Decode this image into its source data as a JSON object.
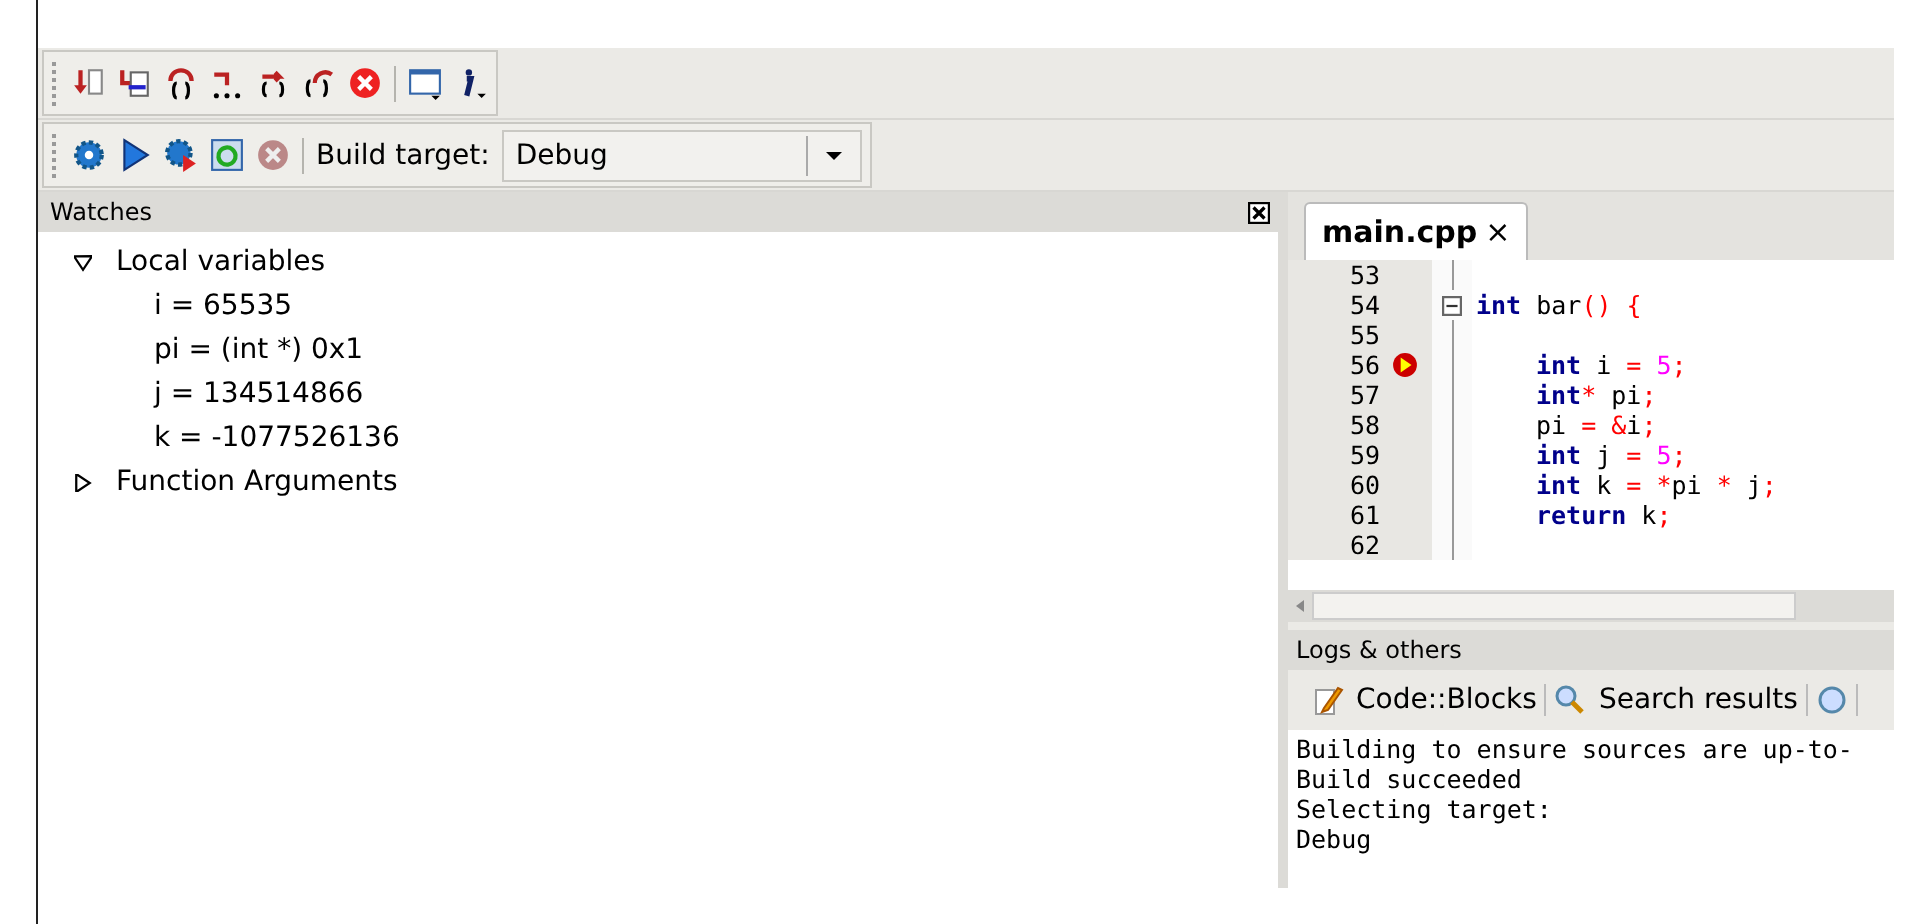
{
  "toolbar": {
    "build_target_label": "Build target:",
    "build_target_value": "Debug"
  },
  "watches": {
    "title": "Watches",
    "items": [
      {
        "label": "Local variables",
        "expanded": true,
        "children": [
          {
            "label": "i = 65535"
          },
          {
            "label": "pi = (int *) 0x1"
          },
          {
            "label": "j = 134514866"
          },
          {
            "label": "k = -1077526136"
          }
        ]
      },
      {
        "label": "Function Arguments",
        "expanded": false
      }
    ]
  },
  "editor": {
    "tab": {
      "label": "main.cpp",
      "close": "×"
    },
    "lines": [
      {
        "number": "53",
        "current": false,
        "fold": false
      },
      {
        "number": "54",
        "current": false,
        "fold": true,
        "indented": false,
        "tokens": [
          {
            "kind": "keyword",
            "text": "int"
          },
          {
            "kind": "plain",
            "text": " bar"
          },
          {
            "kind": "operator",
            "text": "() {"
          }
        ]
      },
      {
        "number": "55",
        "current": false,
        "fold": false
      },
      {
        "number": "56",
        "current": true,
        "fold": false,
        "indented": true,
        "tokens": [
          {
            "kind": "keyword",
            "text": "int"
          },
          {
            "kind": "plain",
            "text": " i "
          },
          {
            "kind": "operator",
            "text": "= "
          },
          {
            "kind": "number",
            "text": "5"
          },
          {
            "kind": "operator",
            "text": ";"
          }
        ]
      },
      {
        "number": "57",
        "current": false,
        "fold": false,
        "indented": true,
        "tokens": [
          {
            "kind": "keyword",
            "text": "int"
          },
          {
            "kind": "operator",
            "text": "*"
          },
          {
            "kind": "plain",
            "text": " pi"
          },
          {
            "kind": "operator",
            "text": ";"
          }
        ]
      },
      {
        "number": "58",
        "current": false,
        "fold": false,
        "indented": true,
        "tokens": [
          {
            "kind": "plain",
            "text": "pi "
          },
          {
            "kind": "operator",
            "text": "= &"
          },
          {
            "kind": "plain",
            "text": "i"
          },
          {
            "kind": "operator",
            "text": ";"
          }
        ]
      },
      {
        "number": "59",
        "current": false,
        "fold": false,
        "indented": true,
        "tokens": [
          {
            "kind": "keyword",
            "text": "int"
          },
          {
            "kind": "plain",
            "text": " j "
          },
          {
            "kind": "operator",
            "text": "= "
          },
          {
            "kind": "number",
            "text": "5"
          },
          {
            "kind": "operator",
            "text": ";"
          }
        ]
      },
      {
        "number": "60",
        "current": false,
        "fold": false,
        "indented": true,
        "tokens": [
          {
            "kind": "keyword",
            "text": "int"
          },
          {
            "kind": "plain",
            "text": " k "
          },
          {
            "kind": "operator",
            "text": "= *"
          },
          {
            "kind": "plain",
            "text": "pi "
          },
          {
            "kind": "operator",
            "text": "*"
          },
          {
            "kind": "plain",
            "text": " j"
          },
          {
            "kind": "operator",
            "text": ";"
          }
        ]
      },
      {
        "number": "61",
        "current": false,
        "fold": false,
        "indented": true,
        "tokens": [
          {
            "kind": "keyword",
            "text": "return"
          },
          {
            "kind": "plain",
            "text": " k"
          },
          {
            "kind": "operator",
            "text": ";"
          }
        ]
      },
      {
        "number": "62",
        "current": false,
        "fold": false
      }
    ]
  },
  "logs": {
    "title": "Logs & others",
    "tabs": [
      {
        "kind": "pencil",
        "label": "Code::Blocks"
      },
      {
        "kind": "search",
        "label": "Search results"
      },
      {
        "kind": "cut"
      }
    ],
    "lines": [
      "Building to ensure sources are up-to-",
      "Build succeeded",
      "Selecting target:",
      "Debug"
    ]
  }
}
